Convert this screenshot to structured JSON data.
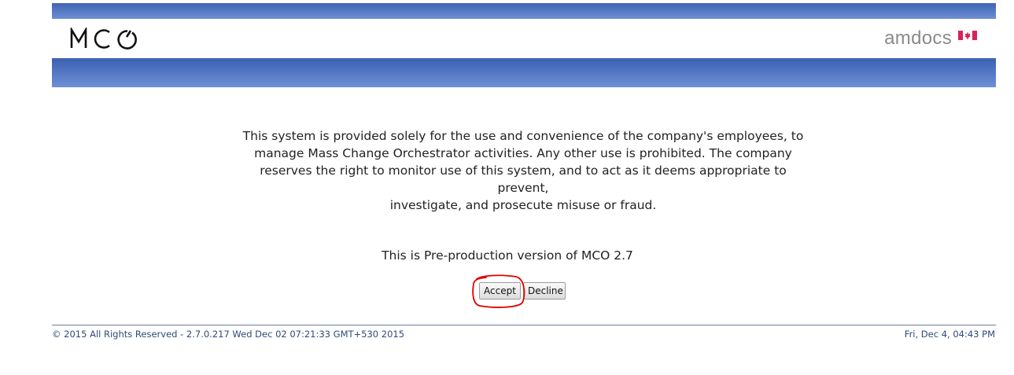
{
  "header": {
    "logo_text": "MCO",
    "brand_text": "amdocs",
    "brand_flag": "canada-flag-icon"
  },
  "colors": {
    "bar_dark": "#3f64b4",
    "bar_light": "#6e8fd4",
    "footer_text": "#2f4a7a",
    "annotation_red": "#e00000"
  },
  "notice": {
    "lines": [
      "This system is provided solely for the use and convenience of the company's employees, to",
      "manage Mass Change Orchestrator activities. Any other use is prohibited. The company",
      "reserves the right to monitor use of this system, and to act as it deems appropriate to prevent,",
      "investigate, and prosecute misuse or fraud."
    ]
  },
  "version_text": "This is Pre-production version of MCO 2.7",
  "actions": {
    "accept_label": "Accept",
    "decline_label": "Decline"
  },
  "footer": {
    "left": "© 2015 All Rights Reserved - 2.7.0.217 Wed Dec 02 07:21:33 GMT+530 2015",
    "right": "Fri, Dec 4, 04:43 PM"
  }
}
